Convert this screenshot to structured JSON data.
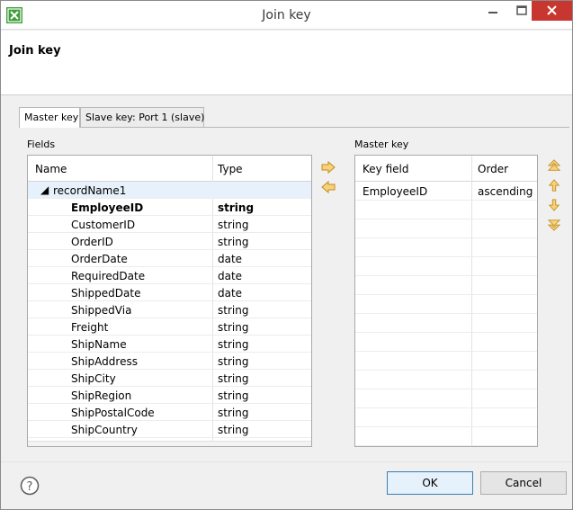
{
  "window": {
    "title": "Join key",
    "header_title": "Join key"
  },
  "tabs": [
    {
      "label": "Master key",
      "active": true
    },
    {
      "label": "Slave key: Port 1 (slave)",
      "active": false
    }
  ],
  "fields_panel": {
    "label": "Fields",
    "columns": [
      "Name",
      "Type"
    ],
    "group": "recordName1",
    "rows": [
      {
        "name": "EmployeeID",
        "type": "string",
        "bold": true
      },
      {
        "name": "CustomerID",
        "type": "string"
      },
      {
        "name": "OrderID",
        "type": "string"
      },
      {
        "name": "OrderDate",
        "type": "date"
      },
      {
        "name": "RequiredDate",
        "type": "date"
      },
      {
        "name": "ShippedDate",
        "type": "date"
      },
      {
        "name": "ShippedVia",
        "type": "string"
      },
      {
        "name": "Freight",
        "type": "string"
      },
      {
        "name": "ShipName",
        "type": "string"
      },
      {
        "name": "ShipAddress",
        "type": "string"
      },
      {
        "name": "ShipCity",
        "type": "string"
      },
      {
        "name": "ShipRegion",
        "type": "string"
      },
      {
        "name": "ShipPostalCode",
        "type": "string"
      },
      {
        "name": "ShipCountry",
        "type": "string"
      }
    ]
  },
  "master_key_panel": {
    "label": "Master key",
    "columns": [
      "Key field",
      "Order"
    ],
    "rows": [
      {
        "key_field": "EmployeeID",
        "order": "ascending"
      }
    ]
  },
  "transfer_buttons": [
    "arrow-right-icon",
    "arrow-left-icon"
  ],
  "order_buttons": [
    "move-top-icon",
    "move-up-icon",
    "move-down-icon",
    "move-bottom-icon"
  ],
  "footer": {
    "ok_label": "OK",
    "cancel_label": "Cancel"
  },
  "colors": {
    "arrow": "#e8b23c",
    "close_button": "#c7372f",
    "selection": "#e6f1fb"
  }
}
